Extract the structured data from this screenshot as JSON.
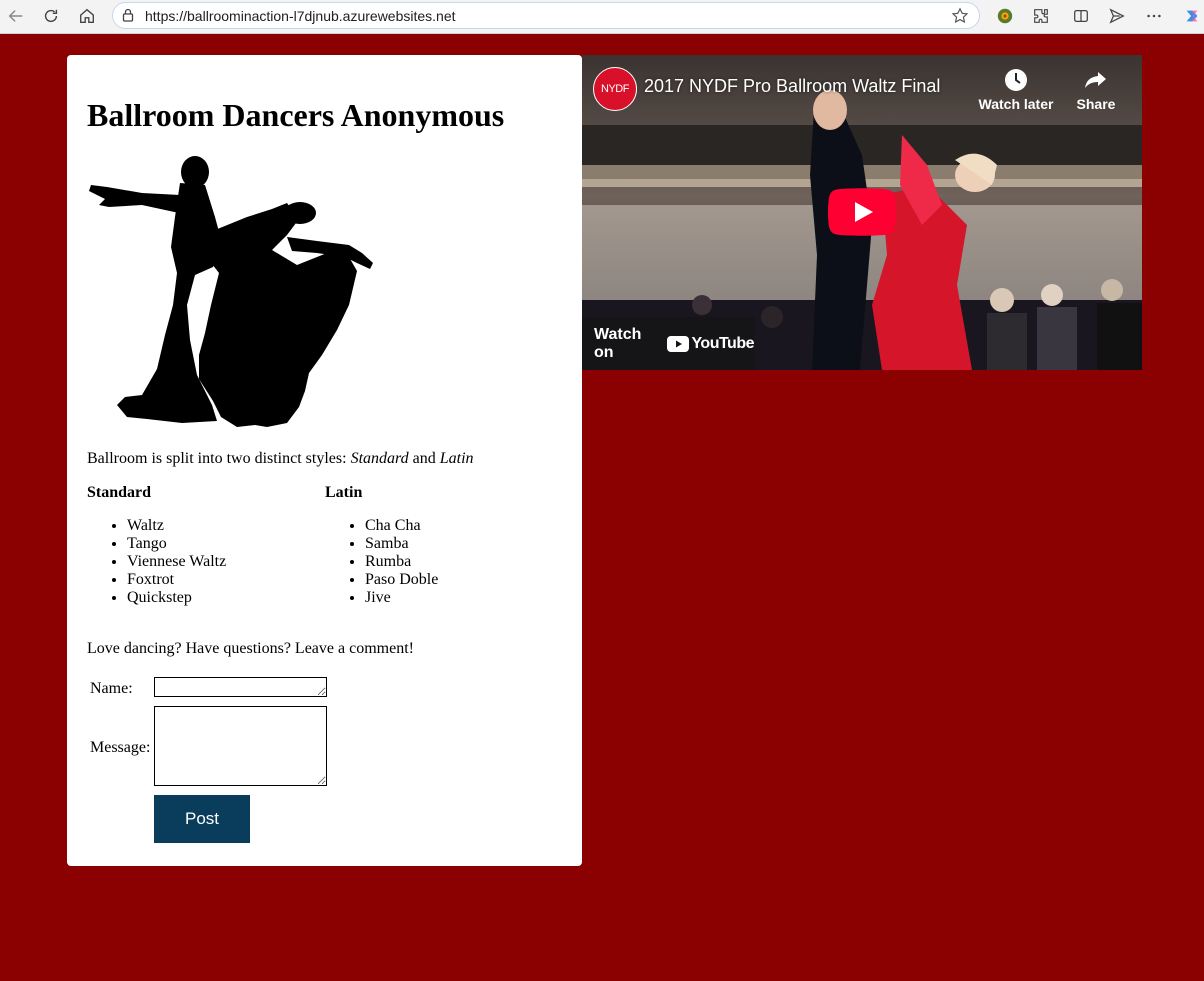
{
  "browser": {
    "url": "https://ballroominaction-l7djnub.azurewebsites.net"
  },
  "page": {
    "title": "Ballroom Dancers Anonymous",
    "intro": {
      "before": "Ballroom is split into two distinct styles: ",
      "standard": "Standard",
      "and": " and ",
      "latin": "Latin"
    },
    "standard": {
      "heading": "Standard",
      "items": [
        "Waltz",
        "Tango",
        "Viennese Waltz",
        "Foxtrot",
        "Quickstep"
      ]
    },
    "latin": {
      "heading": "Latin",
      "items": [
        "Cha Cha",
        "Samba",
        "Rumba",
        "Paso Doble",
        "Jive"
      ]
    },
    "comment_prompt": "Love dancing? Have questions? Leave a comment!",
    "form": {
      "name_label": "Name:",
      "message_label": "Message:",
      "name_value": "",
      "message_value": "",
      "post_label": "Post"
    }
  },
  "video": {
    "channel_logo_text": "NYDF",
    "title": "2017 NYDF Pro Ballroom Waltz Final",
    "watch_later": "Watch later",
    "share": "Share",
    "watch_on": "Watch on",
    "youtube": "YouTube"
  },
  "colors": {
    "page_background": "#8b0000",
    "post_button": "#0a3d5c",
    "youtube_red": "#ff0033"
  }
}
